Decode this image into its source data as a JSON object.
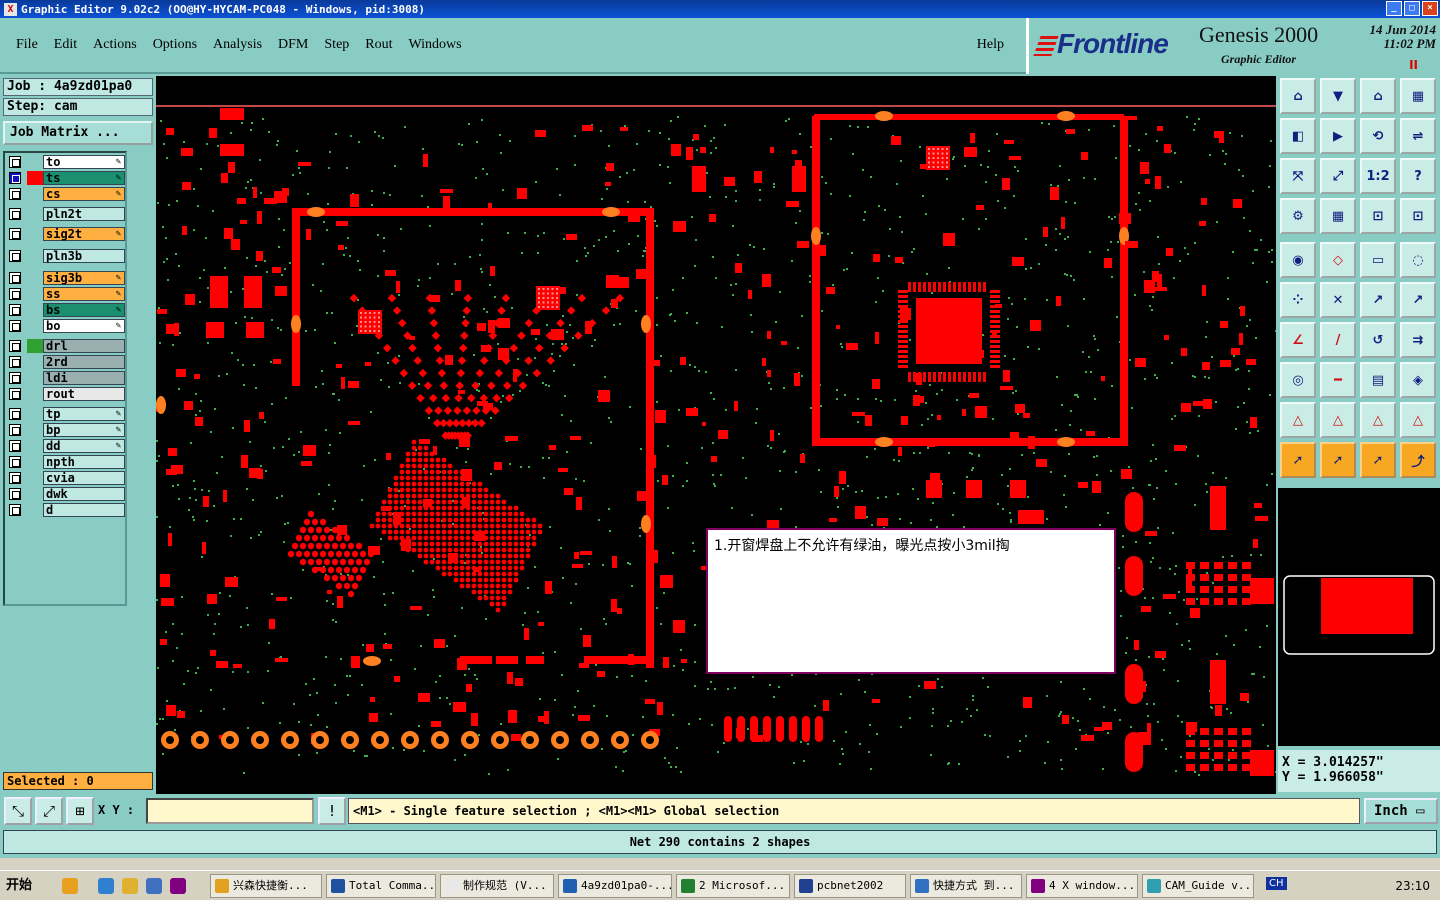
{
  "titlebar": {
    "title": "Graphic Editor 9.02c2 (OO@HY-HYCAM-PC048 - Windows, pid:3008)",
    "icon": "X"
  },
  "menu": {
    "items": [
      "File",
      "Edit",
      "Actions",
      "Options",
      "Analysis",
      "DFM",
      "Step",
      "Rout",
      "Windows"
    ],
    "help": "Help"
  },
  "brand": {
    "logo": "Frontline",
    "product": "Genesis 2000",
    "subtitle": "Graphic Editor",
    "date": "14 Jun 2014",
    "time": "11:02 PM",
    "pause": "II"
  },
  "job": {
    "job_line": "Job : 4a9zd01pa0",
    "step_line": "Step: cam",
    "matrix_button": "Job Matrix ..."
  },
  "layers": [
    {
      "name": "to",
      "bg": "#ffffff",
      "swatch": "",
      "checked": false,
      "editable": true
    },
    {
      "name": "ts",
      "bg": "#1a9070",
      "swatch": "#ff0000",
      "checked": true,
      "editable": true
    },
    {
      "name": "cs",
      "bg": "#ffb040",
      "swatch": "",
      "checked": false,
      "editable": true
    },
    {
      "name": "pln2t",
      "bg": "#bfe8e2",
      "swatch": "",
      "checked": false,
      "editable": false
    },
    {
      "name": "sig2t",
      "bg": "#ffb040",
      "swatch": "",
      "checked": false,
      "editable": true
    },
    {
      "name": "pln3b",
      "bg": "#bfe8e2",
      "swatch": "",
      "checked": false,
      "editable": false
    },
    {
      "name": "sig3b",
      "bg": "#ffb040",
      "swatch": "",
      "checked": false,
      "editable": true
    },
    {
      "name": "ss",
      "bg": "#ffb040",
      "swatch": "",
      "checked": false,
      "editable": true
    },
    {
      "name": "bs",
      "bg": "#1a9070",
      "swatch": "",
      "checked": false,
      "editable": true
    },
    {
      "name": "bo",
      "bg": "#ffffff",
      "swatch": "",
      "checked": false,
      "editable": true
    },
    {
      "name": "drl",
      "bg": "#9ab0b0",
      "swatch": "#30a030",
      "checked": false,
      "editable": false
    },
    {
      "name": "2rd",
      "bg": "#9ab0b0",
      "swatch": "",
      "checked": false,
      "editable": false
    },
    {
      "name": "ldi",
      "bg": "#9ab0b0",
      "swatch": "",
      "checked": false,
      "editable": false
    },
    {
      "name": "rout",
      "bg": "#e8e8e8",
      "swatch": "",
      "checked": false,
      "editable": false
    },
    {
      "name": "tp",
      "bg": "#bfe8e2",
      "swatch": "",
      "checked": false,
      "editable": true
    },
    {
      "name": "bp",
      "bg": "#bfe8e2",
      "swatch": "",
      "checked": false,
      "editable": true
    },
    {
      "name": "dd",
      "bg": "#bfe8e2",
      "swatch": "",
      "checked": false,
      "editable": true
    },
    {
      "name": "npth",
      "bg": "#bfe8e2",
      "swatch": "",
      "checked": false,
      "editable": false
    },
    {
      "name": "cvia",
      "bg": "#bfe8e2",
      "swatch": "",
      "checked": false,
      "editable": false
    },
    {
      "name": "dwk",
      "bg": "#bfe8e2",
      "swatch": "",
      "checked": false,
      "editable": false
    },
    {
      "name": "d",
      "bg": "#bfe8e2",
      "swatch": "",
      "checked": false,
      "editable": false
    }
  ],
  "selected": "Selected : 0",
  "note": "1.开窗焊盘上不允许有绿油，曝光点按小3mil掏",
  "coords": {
    "x": "X = 3.014257\"",
    "y": "Y = 1.966058\""
  },
  "bottom": {
    "xy_label": "X Y :",
    "xy_value": "",
    "message": "<M1> - Single feature selection ; <M1><M1> Global selection",
    "units": "Inch",
    "status": "Net 290 contains 2 shapes"
  },
  "taskbar": {
    "start": "开始",
    "items": [
      "兴森快捷衡...",
      "Total Comma...",
      "制作规范 (V...",
      "4a9zd01pa0-...",
      "2 Microsof...",
      "pcbnet2002",
      "快捷方式 到...",
      "4 X window...",
      "CAM_Guide v..."
    ],
    "clock": "23:10",
    "lang": "CH"
  },
  "colors": {
    "pcb_copper": "#ff0000",
    "pcb_via": "#3cb050",
    "background": "#000000",
    "panel": "#88ccc4"
  },
  "toolbox_icons": [
    "zoom-home-icon",
    "zoom-in-icon",
    "zoom-out-icon",
    "zoom-fit-icon",
    "pan-left-icon",
    "pan-right-icon",
    "swap-icon",
    "redraw-icon",
    "fit-step-icon",
    "fit-profile-icon",
    "scale-1-2-icon",
    "help-icon",
    "measure-icon",
    "grid-icon",
    "snap-icon",
    "snap2-icon",
    "add-pad-icon",
    "add-line-icon",
    "ruler-icon",
    "select-box-icon",
    "net-icon",
    "cross-icon",
    "connect-icon",
    "connect2-icon",
    "angle-icon",
    "slash-icon",
    "arc-icon",
    "mirror-icon",
    "features-icon",
    "line-split-icon",
    "dim-icon",
    "round-icon",
    "surface-icon",
    "surface2-icon",
    "surface3-icon",
    "surface4-icon",
    "pointer-icon",
    "pointer2-icon",
    "pointer3-icon",
    "route-icon"
  ]
}
